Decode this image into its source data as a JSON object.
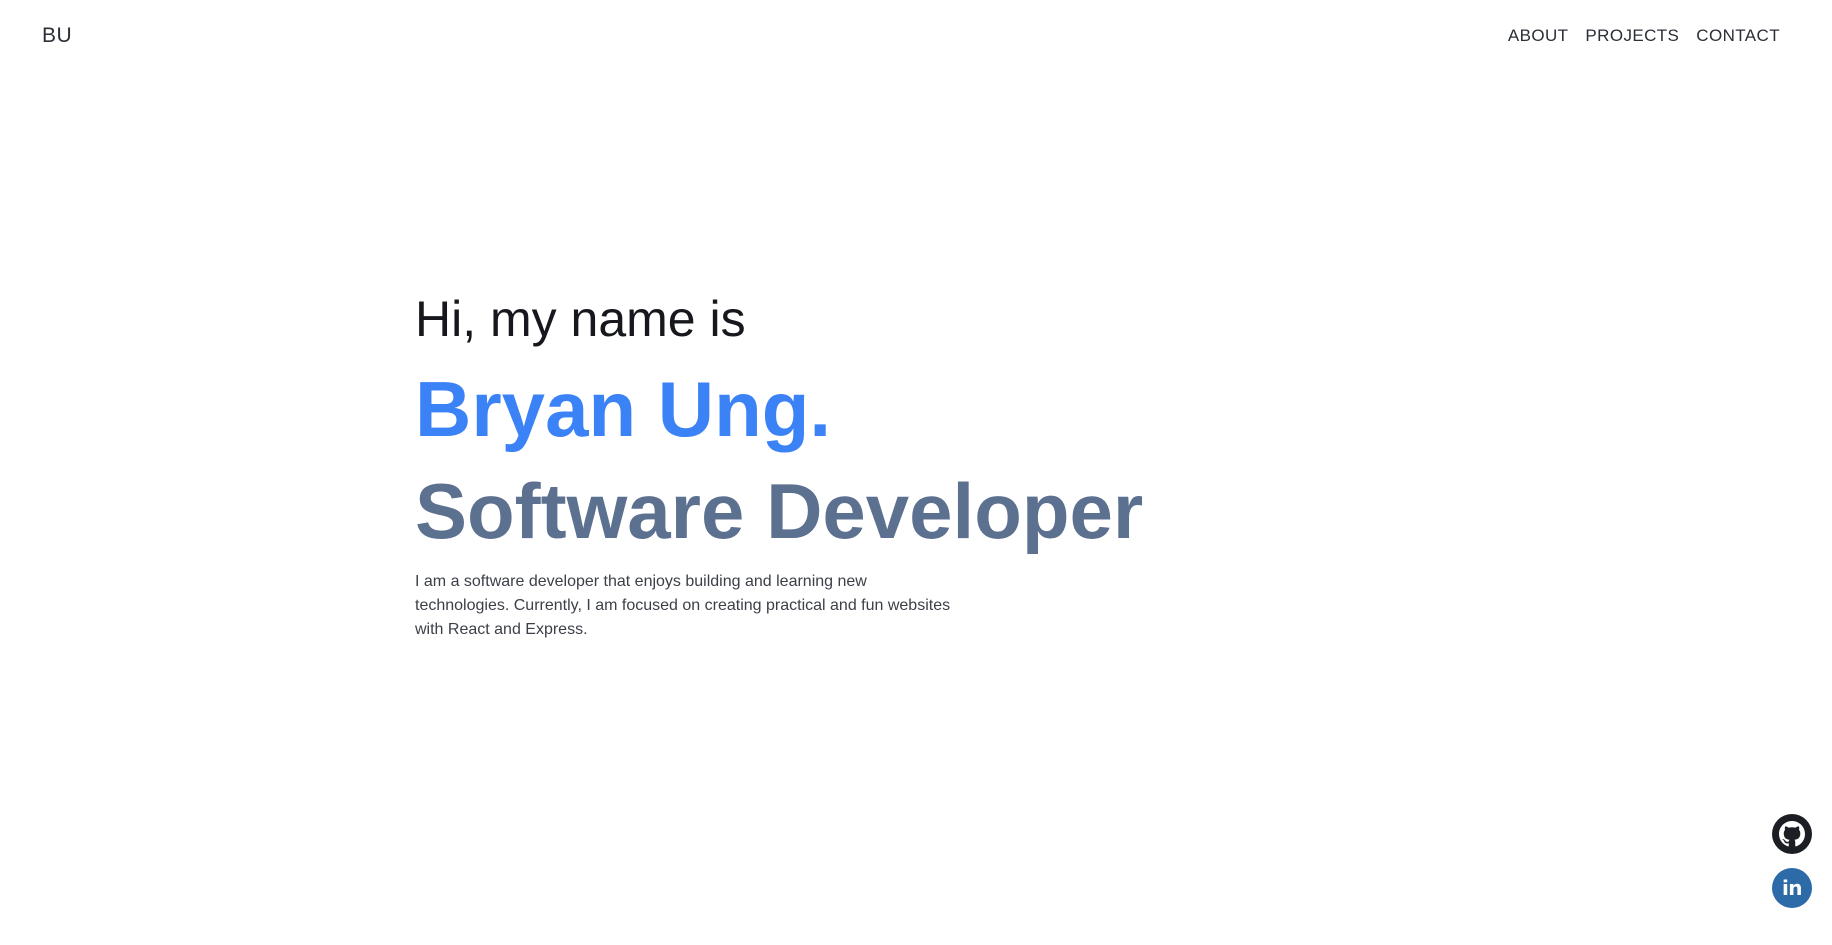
{
  "navbar": {
    "logo": "BU",
    "links": [
      {
        "label": "ABOUT"
      },
      {
        "label": "PROJECTS"
      },
      {
        "label": "CONTACT"
      }
    ]
  },
  "hero": {
    "greeting": "Hi, my name is",
    "name": "Bryan Ung.",
    "role": "Software Developer",
    "bio": "I am a software developer that enjoys building and learning new technologies. Currently, I am focused on creating practical and fun websites with React and Express."
  },
  "social": {
    "github_icon": "github-icon",
    "linkedin_icon": "linkedin-icon",
    "linkedin_glyph": "in"
  },
  "colors": {
    "accent": "#3b82f6",
    "role": "#5c708f",
    "text": "#16181d",
    "github": "#1b1f24",
    "linkedin": "#2d6aa8"
  }
}
